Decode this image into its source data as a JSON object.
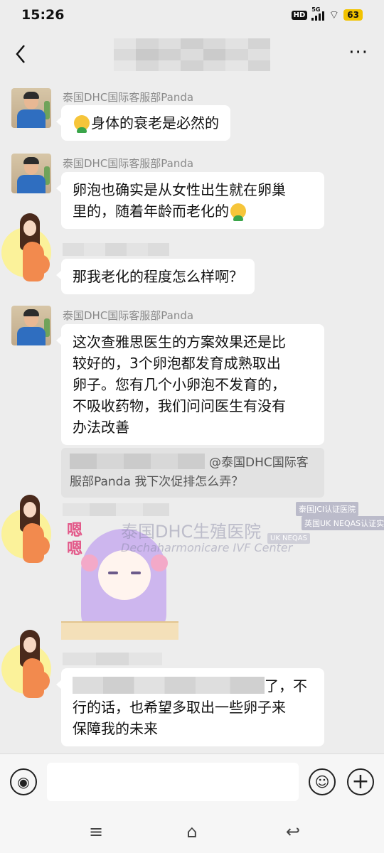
{
  "status": {
    "time": "15:26",
    "hd": "HD",
    "network": "5G",
    "battery": "63"
  },
  "header": {
    "back_icon": "chevron-left-icon",
    "more_label": "···"
  },
  "messages": [
    {
      "sender": "泰国DHC国际客服部Panda",
      "text": "身体的衰老是必然的"
    },
    {
      "sender": "泰国DHC国际客服部Panda",
      "text_line1": "卵泡也确实是从女性出生就在卵巢",
      "text_line2": "里的，随着年龄而老化的"
    },
    {
      "sender": "",
      "text": "那我老化的程度怎么样啊？"
    },
    {
      "sender": "泰国DHC国际客服部Panda",
      "lines": [
        "这次查雅思医生的方案效果还是比",
        "较好的，3个卵泡都发育成熟取出",
        "卵子。您有几个小卵泡不发育的，",
        "不吸收药物，我们问问医生有没有",
        "办法改善"
      ]
    },
    {
      "quote_line1": "@泰国DHC国际客",
      "quote_line2": "服部Panda 我下次促排怎么弄？"
    },
    {
      "sticker_text": "嗯嗯"
    },
    {
      "text_line1_tail": "了，不",
      "text_line2": "行的话，也希望多取出一些卵子来",
      "text_line3": "保障我的未来"
    }
  ],
  "watermark": {
    "main": "泰国DHC生殖医院",
    "sub": "Dechaharmonicare IVF Center",
    "badge1": "泰国JCI认证医院",
    "badge2": "英国UK NEQAS认证实验室",
    "badge_neqas": "UK NEQAS"
  },
  "input": {
    "placeholder": ""
  },
  "nav": {
    "menu_icon": "menu-icon",
    "home_icon": "home-icon",
    "back_icon": "back-icon"
  }
}
